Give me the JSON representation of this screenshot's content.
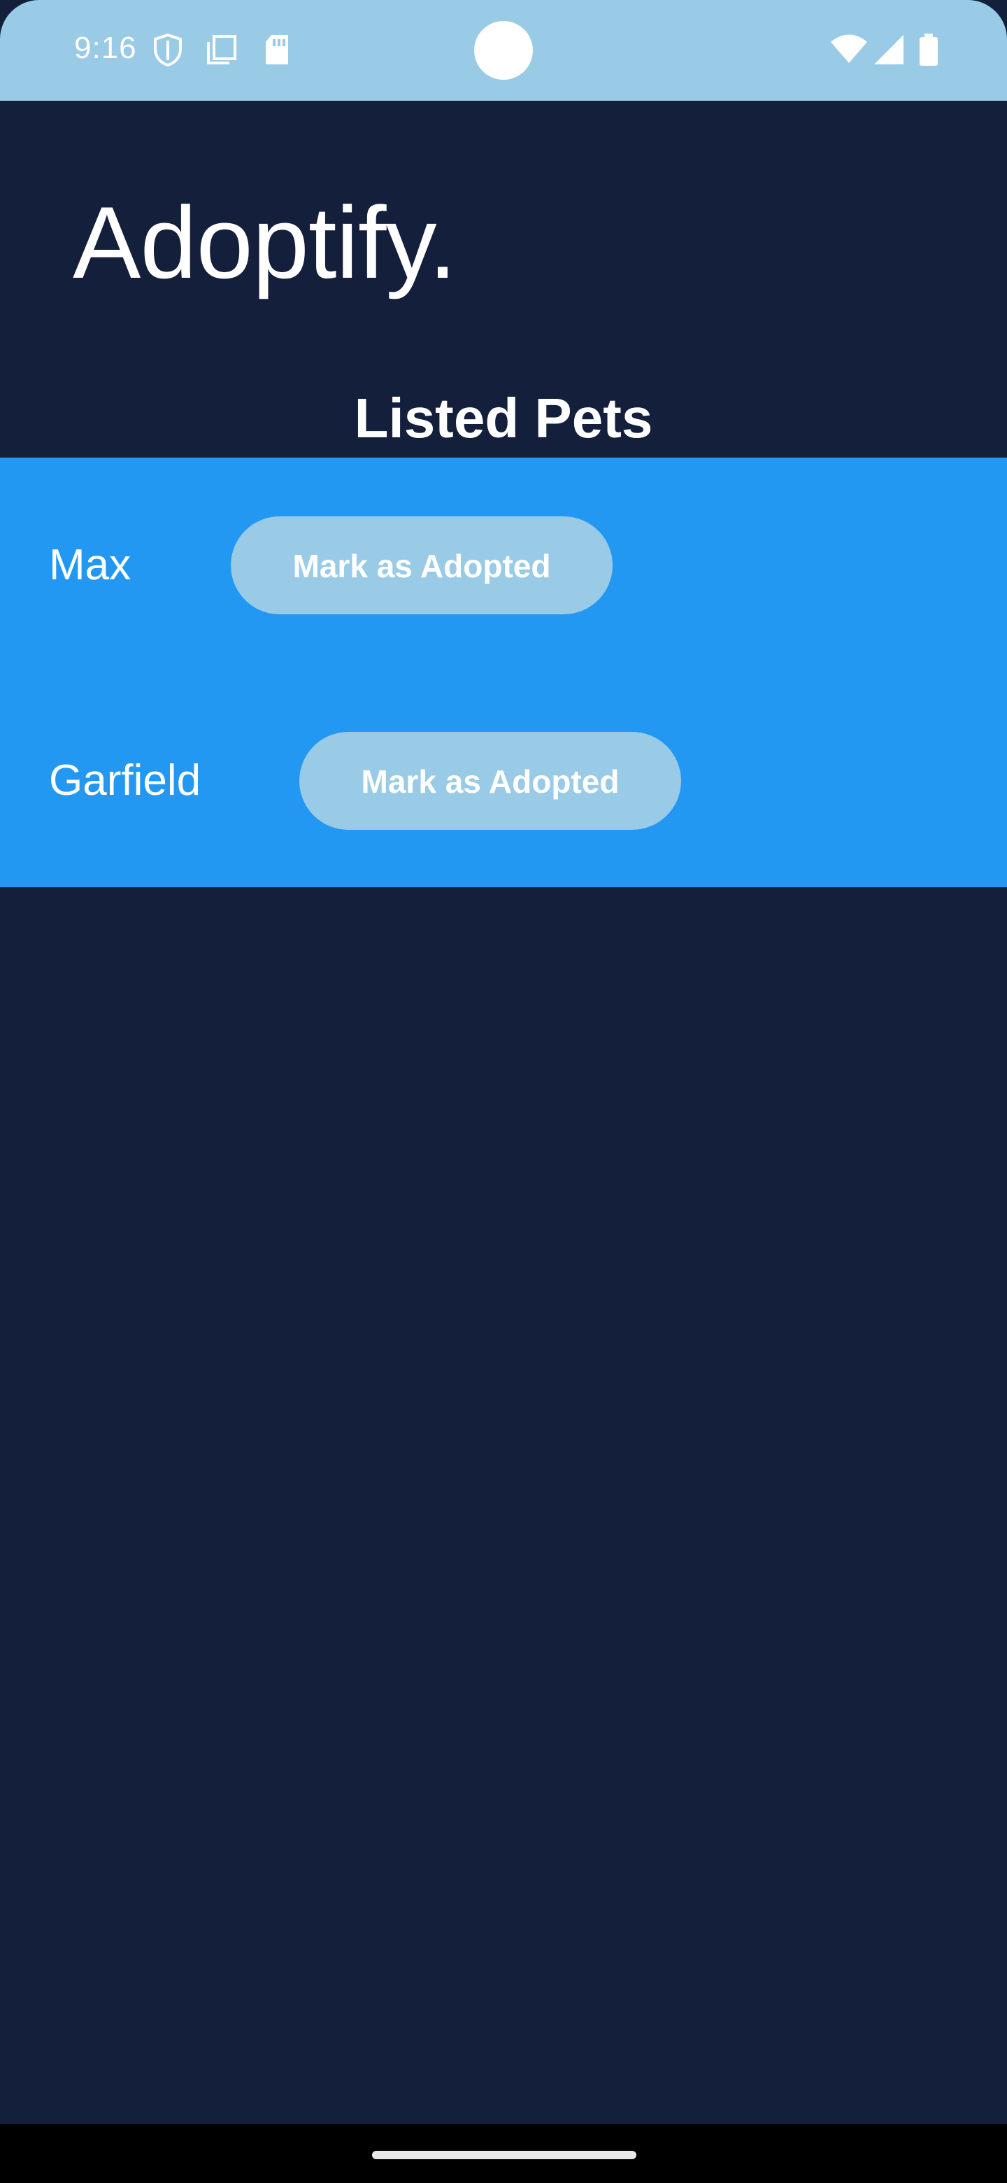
{
  "status_bar": {
    "time": "9:16",
    "left_icons": [
      "shield-icon",
      "copy-icon",
      "sd-card-icon"
    ],
    "right_icons": [
      "wifi-icon",
      "signal-icon",
      "battery-icon"
    ],
    "background_color": "#9acbe6"
  },
  "app": {
    "title": "Adoptify.",
    "section_title": "Listed Pets",
    "background_color": "#131f3b",
    "accent_color": "#2398f2",
    "button_color": "#9acbe6"
  },
  "pets": [
    {
      "name": "Max",
      "action_label": "Mark as Adopted"
    },
    {
      "name": "Garfield",
      "action_label": "Mark as Adopted"
    }
  ]
}
